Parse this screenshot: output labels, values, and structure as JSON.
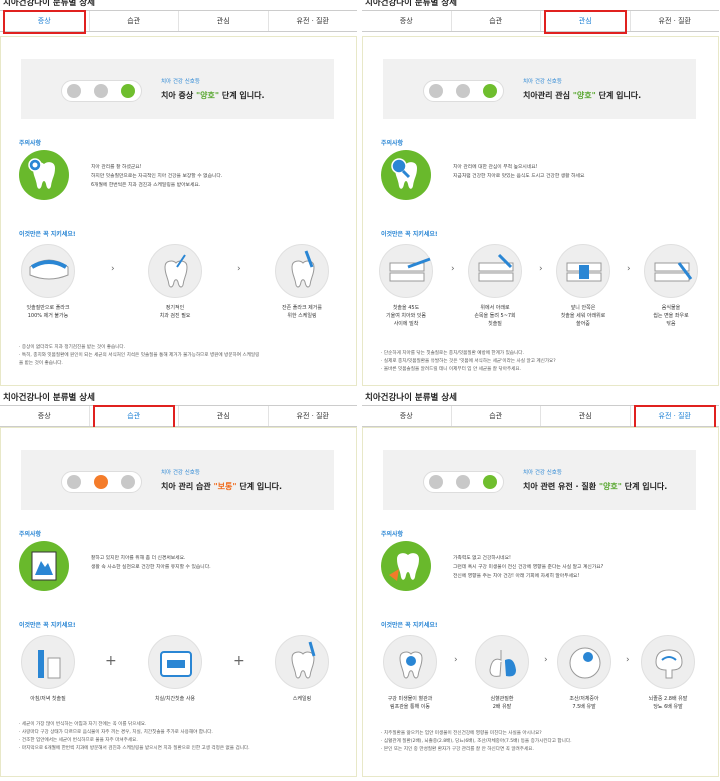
{
  "quadrants": {
    "tl": {
      "title": "치아건강나이 분류별 상세",
      "tabs": [
        "증상",
        "습관",
        "관심",
        "유전 · 질환"
      ],
      "status_small": "치아 건강 신호등",
      "status_prefix": "치아 증상 ",
      "status_value": "\"양호\"",
      "status_suffix": " 단계 입니다.",
      "caution_title": "주의사항",
      "caution_lines": [
        "치아 관리를 잘 하셨군요!",
        "하지만 잇솔질만으로는 자극적인 치아 건강을 보장할 수 없습니다.",
        "6개월에 한번씩은 치과 검진과 스케일링을 받아보세요."
      ],
      "tips_title": "이것만은 꼭 지키세요!",
      "steps": [
        [
          "잇솔질만으로 플라크",
          "100% 제거 불가능"
        ],
        [
          "정기적인",
          "치과 검진 필요"
        ],
        [
          "잔존 플라크 제거를",
          "위한 스케일링"
        ]
      ],
      "notes": [
        "· 증상이 없더라도 치과 정기검진을 받는 것이 좋습니다.",
        "· 특히, 충치와 잇몸질환에 원인이 되는 세균의 서식처인 치석은 잇솔질을 통해 제거가 불가능하므로 병원에 방문하여 스케일링",
        "   을 받는 것이 좋습니다."
      ]
    },
    "tr": {
      "title": "치아건강나이 분류별 상세",
      "tabs": [
        "증상",
        "습관",
        "관심",
        "유전 · 질환"
      ],
      "status_small": "치아 건강 신호등",
      "status_prefix": "치아관리 관심 ",
      "status_value": "\"양호\"",
      "status_suffix": " 단계 입니다.",
      "caution_title": "주의사항",
      "caution_lines": [
        "치아 관리에 대한 관심이 무척 높으시네요!",
        "지금처럼 건강한 치아로 맛있는 음식도 드시고 건강한 생활 하세요"
      ],
      "tips_title": "이것만은 꼭 지키세요!",
      "steps": [
        [
          "칫솔을 45도",
          "기울여 치아와 잇몸",
          "사이에 밀착"
        ],
        [
          "위에서 아래로",
          "손목을 돌려 5~7회",
          "칫솔질"
        ],
        [
          "앞니 안쪽은",
          "칫솔을 세워 아래위로",
          "쓸어줌"
        ],
        [
          "음식물을",
          "씹는 면을 좌우로",
          "닦음"
        ]
      ],
      "notes": [
        "· 단순하게 치아를 닦는 칫솔질로는 충치/잇몸질환 예방에 한계가 있습니다.",
        "· 실제로 충치/잇몸질환을 유발하는 것은 '잇몸에 서식하는 세균'이라는 사실 알고 계신가요?",
        "· 올바른 잇몸솔질을 알려드릴 테니 이제부터 입 안 세균을 잘 닦아주세요."
      ]
    },
    "bl": {
      "title": "치아건강나이 분류별 상세",
      "tabs": [
        "증상",
        "습관",
        "관심",
        "유전 · 질환"
      ],
      "status_small": "치아 건강 신호등",
      "status_prefix": "치아 관리 습관 ",
      "status_value": "\"보통\"",
      "status_suffix": " 단계 입니다.",
      "caution_title": "주의사항",
      "caution_lines": [
        "잘하고 있지만 치아를 위해 좀 더 신경써보세요.",
        "생활 속 사소한 실천으로 건강한 치아를 유지할 수 있습니다."
      ],
      "tips_title": "이것만은 꼭 지키세요!",
      "steps": [
        [
          "아침/저녁 칫솔질"
        ],
        [
          "치실/치간칫솔 사용"
        ],
        [
          "스케일링"
        ]
      ],
      "notes": [
        "· 세균이 가장 많이 번식하는 아침과 자기 전에는 꼭 이를 닦으세요.",
        "· 사랑마다 구강 상태가 다르므로 음식물이 자주 끼는 경우, 치실, 치간칫솔을 추가로 사용해야 합니다.",
        "· 건조한 입안에서는 세균이 번식하므로 물을 자주 마셔주세요.",
        "· 마지막으로 6개월에 한번씩 치과에 방문해서 검진과 스케일링을 받으시면 치과 질환으로 인한 고생 걱정은 없을 겁니다."
      ]
    },
    "br": {
      "title": "치아건강나이 분류별 상세",
      "tabs": [
        "증상",
        "습관",
        "관심",
        "유전 · 질환"
      ],
      "status_small": "치아 건강 신호등",
      "status_prefix": "치아 관련 유전 · 질환 ",
      "status_value": "\"양호\"",
      "status_suffix": " 단계 입니다.",
      "caution_title": "주의사항",
      "caution_lines": [
        "가족력도 없고 건강하시네요!",
        "그런데 혹시 구강 미생물이 전신 건강에 영향을 준다는 사실 알고 계신가요?",
        "전신에 영향을 주는 치아 건강! 아래 기회에 자세히 알아두세요!"
      ],
      "tips_title": "이것만은 꼭 지키세요!",
      "steps": [
        [
          "구강 미생물이 혈관과",
          "림프관을 통해 이동"
        ],
        [
          "심혈관질환",
          "2배 유발"
        ],
        [
          "조산/저체중아",
          "7.5배 유발"
        ],
        [
          "뇌졸중 2.8배 유발",
          "당뇨 6배 유발"
        ]
      ],
      "notes": [
        "· 치주질환을 앓으키는 입안 미생물이 전신건강에 영향을 미친다는 사실을 아시나요?",
        "· 심혈관계 질환(2배), 뇌졸중(2.8배), 당뇨(6배), 조산/저체중아(7.5배) 등을 증가시킨다고 합니다.",
        "· 본인 또는 지인 중 만성질환 환자가 구강 관리를 잘 안 하신다면 꼭 알려주세요."
      ]
    }
  },
  "colors": {
    "accent_blue": "#2a86d4",
    "green": "#6fbe2e",
    "orange": "#f47c2a",
    "highlight_red": "#e0211f"
  }
}
